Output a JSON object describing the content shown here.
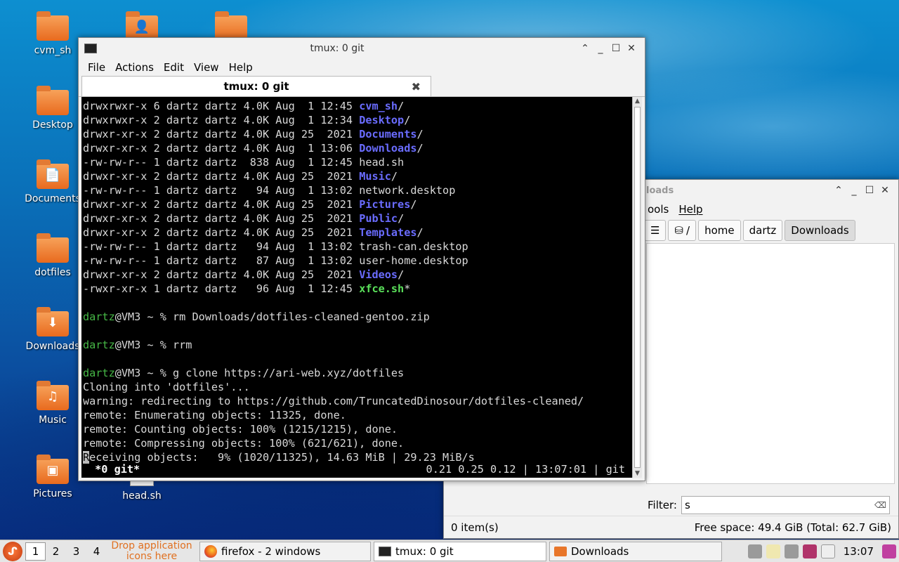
{
  "desktop": {
    "icons": [
      {
        "label": "cvm_sh"
      },
      {
        "label": "Desktop"
      },
      {
        "label": "Documents"
      },
      {
        "label": "dotfiles"
      },
      {
        "label": "Downloads"
      },
      {
        "label": "Music"
      },
      {
        "label": "Pictures"
      },
      {
        "label": "head.sh"
      }
    ]
  },
  "terminal": {
    "title": "tmux: 0 git",
    "menu": [
      "File",
      "Actions",
      "Edit",
      "View",
      "Help"
    ],
    "tab_label": "tmux: 0 git",
    "listing": [
      {
        "meta": "drwxrwxr-x 6 dartz dartz 4.0K Aug  1 12:45 ",
        "name": "cvm_sh",
        "suffix": "/",
        "kind": "dir"
      },
      {
        "meta": "drwxrwxr-x 2 dartz dartz 4.0K Aug  1 12:34 ",
        "name": "Desktop",
        "suffix": "/",
        "kind": "dir"
      },
      {
        "meta": "drwxr-xr-x 2 dartz dartz 4.0K Aug 25  2021 ",
        "name": "Documents",
        "suffix": "/",
        "kind": "dir"
      },
      {
        "meta": "drwxr-xr-x 2 dartz dartz 4.0K Aug  1 13:06 ",
        "name": "Downloads",
        "suffix": "/",
        "kind": "dir"
      },
      {
        "meta": "-rw-rw-r-- 1 dartz dartz  838 Aug  1 12:45 ",
        "name": "head.sh",
        "suffix": "",
        "kind": "file"
      },
      {
        "meta": "drwxr-xr-x 2 dartz dartz 4.0K Aug 25  2021 ",
        "name": "Music",
        "suffix": "/",
        "kind": "dir"
      },
      {
        "meta": "-rw-rw-r-- 1 dartz dartz   94 Aug  1 13:02 ",
        "name": "network.desktop",
        "suffix": "",
        "kind": "file"
      },
      {
        "meta": "drwxr-xr-x 2 dartz dartz 4.0K Aug 25  2021 ",
        "name": "Pictures",
        "suffix": "/",
        "kind": "dir"
      },
      {
        "meta": "drwxr-xr-x 2 dartz dartz 4.0K Aug 25  2021 ",
        "name": "Public",
        "suffix": "/",
        "kind": "dir"
      },
      {
        "meta": "drwxr-xr-x 2 dartz dartz 4.0K Aug 25  2021 ",
        "name": "Templates",
        "suffix": "/",
        "kind": "dir"
      },
      {
        "meta": "-rw-rw-r-- 1 dartz dartz   94 Aug  1 13:02 ",
        "name": "trash-can.desktop",
        "suffix": "",
        "kind": "file"
      },
      {
        "meta": "-rw-rw-r-- 1 dartz dartz   87 Aug  1 13:02 ",
        "name": "user-home.desktop",
        "suffix": "",
        "kind": "file"
      },
      {
        "meta": "drwxr-xr-x 2 dartz dartz 4.0K Aug 25  2021 ",
        "name": "Videos",
        "suffix": "/",
        "kind": "dir"
      },
      {
        "meta": "-rwxr-xr-x 1 dartz dartz   96 Aug  1 12:45 ",
        "name": "xfce.sh",
        "suffix": "*",
        "kind": "exe"
      }
    ],
    "prompt_user": "dartz",
    "prompt_rest": "@VM3 ~ % ",
    "commands": [
      "rm Downloads/dotfiles-cleaned-gentoo.zip",
      "rrm",
      "g clone https://ari-web.xyz/dotfiles"
    ],
    "output": [
      "Cloning into 'dotfiles'...",
      "warning: redirecting to https://github.com/TruncatedDinosour/dotfiles-cleaned/",
      "remote: Enumerating objects: 11325, done.",
      "remote: Counting objects: 100% (1215/1215), done.",
      "remote: Compressing objects: 100% (621/621), done."
    ],
    "progress_first_char": "R",
    "progress_rest": "eceiving objects:   9% (1020/11325), 14.63 MiB | 29.23 MiB/s",
    "status_left": " *0 git*",
    "status_right": "0.21 0.25 0.12 | 13:07:01 | git"
  },
  "filemanager": {
    "title_partial": "loads",
    "menu": [
      "ools",
      "Help"
    ],
    "path": [
      "/",
      "home",
      "dartz",
      "Downloads"
    ],
    "filter_label": "Filter:",
    "filter_value": "s",
    "items_count": "0 item(s)",
    "free_space": "Free space: 49.4 GiB (Total: 62.7 GiB)"
  },
  "taskbar": {
    "workspaces": [
      "1",
      "2",
      "3",
      "4"
    ],
    "drop_text": "Drop application icons here",
    "tasks": [
      {
        "label": "firefox - 2 windows"
      },
      {
        "label": "tmux: 0 git"
      },
      {
        "label": "Downloads"
      }
    ],
    "clock": "13:07"
  },
  "colors": {
    "dir": "#6a6cff",
    "exe": "#5ae05a",
    "user": "#46b846",
    "accent": "#e07020"
  }
}
